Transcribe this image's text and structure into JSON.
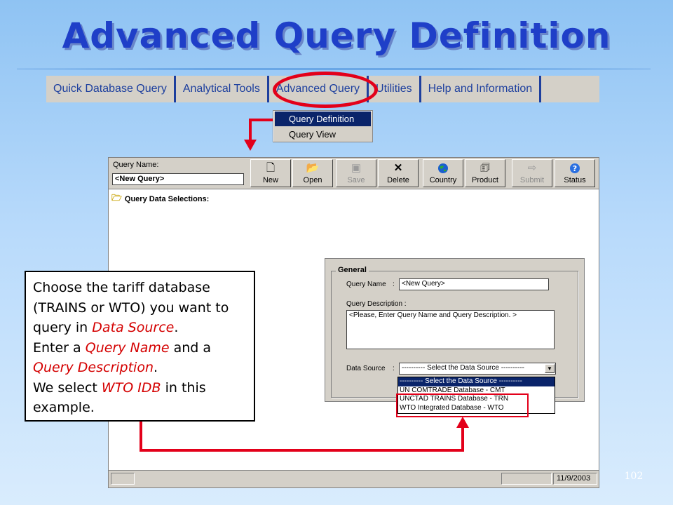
{
  "slide": {
    "title": "Advanced Query Definition",
    "page_number": "102"
  },
  "menubar": {
    "items": [
      {
        "label": "Quick Database Query"
      },
      {
        "label": "Analytical Tools"
      },
      {
        "label": "Advanced Query"
      },
      {
        "label": "Utilities"
      },
      {
        "label": "Help and Information"
      }
    ]
  },
  "dropdown": {
    "items": [
      {
        "label": "Query Definition",
        "selected": true
      },
      {
        "label": "Query View",
        "selected": false
      }
    ]
  },
  "app": {
    "query_name_label": "Query Name:",
    "query_name_value": "<New Query>",
    "toolbar": [
      {
        "label": "New",
        "icon": "new-document-icon",
        "enabled": true
      },
      {
        "label": "Open",
        "icon": "open-folder-icon",
        "enabled": true
      },
      {
        "label": "Save",
        "icon": "save-disk-icon",
        "enabled": false
      },
      {
        "label": "Delete",
        "icon": "delete-x-icon",
        "enabled": true
      },
      {
        "label": "Country",
        "icon": "globe-icon",
        "enabled": true
      },
      {
        "label": "Product",
        "icon": "product-icon",
        "enabled": true
      },
      {
        "label": "Submit",
        "icon": "submit-icon",
        "enabled": false
      },
      {
        "label": "Status",
        "icon": "help-status-icon",
        "enabled": true
      }
    ],
    "query_data_selections": "Query Data Selections:",
    "general": {
      "legend": "General",
      "query_name_label": "Query Name",
      "query_name_value": "<New Query>",
      "query_description_label": "Query Description :",
      "query_description_value": "<Please, Enter Query Name and Query Description. >",
      "data_source_label": "Data Source",
      "data_source_value": "---------- Select the Data Source ----------",
      "data_source_options": [
        {
          "label": "---------- Select the Data Source ----------",
          "selected": true
        },
        {
          "label": "UN COMTRADE Database - CMT",
          "selected": false
        },
        {
          "label": "UNCTAD TRAINS Database - TRN",
          "selected": false
        },
        {
          "label": "WTO Integrated Database - WTO",
          "selected": false
        }
      ]
    },
    "statusbar": {
      "date": "11/9/2003"
    }
  },
  "callout": {
    "s1": "Choose the tariff database (TRAINS or WTO) you want to query in ",
    "s1_hl": "Data Source",
    "s1_end": ".",
    "s2": "Enter a ",
    "s2_hl": "Query Name",
    "s2_mid": " and a ",
    "s2_hl2": "Query Description",
    "s2_end": ".",
    "s3": "We select ",
    "s3_hl": "WTO IDB",
    "s3_end": " in this example."
  },
  "colors": {
    "title": "#1f3fc8",
    "menu_text": "#1d3f9e",
    "highlight_red": "#e3001a",
    "selection_blue": "#0a246a",
    "callout_emphasis": "#d40000"
  }
}
